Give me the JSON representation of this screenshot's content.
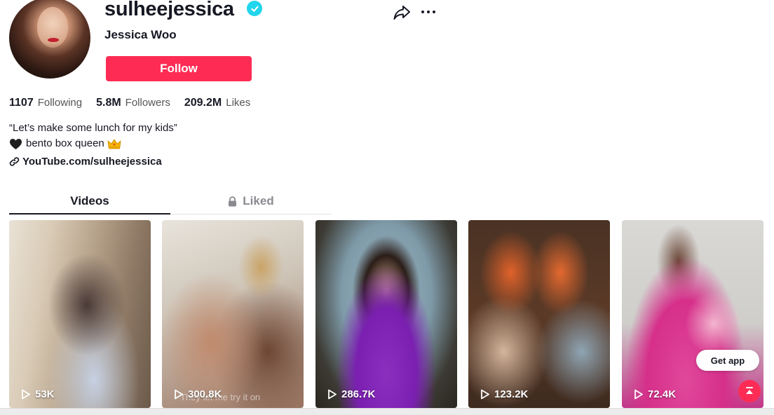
{
  "profile": {
    "username": "sulheejessica",
    "nickname": "Jessica Woo",
    "verified": true,
    "follow_label": "Follow"
  },
  "stats": [
    {
      "value": "1107",
      "label": "Following"
    },
    {
      "value": "5.8M",
      "label": "Followers"
    },
    {
      "value": "209.2M",
      "label": "Likes"
    }
  ],
  "bio": {
    "line1": "“Let’s make some lunch for my kids”",
    "line2": "bento box queen",
    "line2_prefix_icon": "black-heart-icon",
    "line2_suffix_icon": "crown-icon",
    "link": "YouTube.com/sulheejessica"
  },
  "tabs": [
    {
      "label": "Videos",
      "active": true
    },
    {
      "label": "Liked",
      "active": false,
      "icon": "lock-icon"
    }
  ],
  "videos": [
    {
      "views": "53K"
    },
    {
      "views": "300.8K",
      "caption": "They let me try it on"
    },
    {
      "views": "286.7K"
    },
    {
      "views": "123.2K"
    },
    {
      "views": "72.4K"
    }
  ],
  "floating": {
    "get_app_label": "Get app",
    "back_to_top_icon": "arrow-up-icon"
  },
  "colors": {
    "accent": "#fe2c55",
    "verified": "#20d5ec",
    "text": "#161823"
  }
}
